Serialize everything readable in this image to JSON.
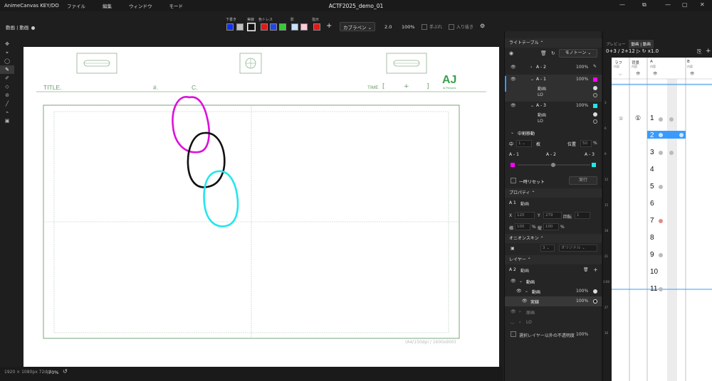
{
  "titlebar": {
    "app_name": "AnimeCanvas KEY/DO",
    "menus": [
      "ファイル",
      "編集",
      "ウィンドウ",
      "モード"
    ],
    "document_title": "ACTF2025_demo_01",
    "window_buttons": [
      "—",
      "⧉",
      "—",
      "▢",
      "✕"
    ]
  },
  "toolbar": {
    "layer_name": "動画 | 動画",
    "swatch_labels": [
      "下書き",
      "実線",
      "色トレス",
      "影",
      "指示"
    ],
    "swatches": [
      "#1133ee",
      "#c0c0c0",
      "#111111",
      "#e01818",
      "#2244ee",
      "#33cc33",
      "#c8e0ff",
      "#ffc8dc",
      "#e01818"
    ],
    "add_label": "+",
    "brush_name": "カブラペン",
    "brush_size": "2.0",
    "opacity": "100%",
    "stabilizer_label": "手ぶれ",
    "pressure_label": "入り抜き",
    "gear": "⚙"
  },
  "tools": [
    "✥",
    "⌖",
    "◯",
    "✎",
    "✐",
    "◇",
    "⊘",
    "╱",
    "⌁",
    "▣"
  ],
  "canvas": {
    "title_label": "TITLE.",
    "number_label": "#.",
    "cut_label": "C.",
    "time_label": "TIME",
    "time_bracket_open": "[",
    "time_plus": "+",
    "time_bracket_close": "]",
    "logo_text": "AJ",
    "logo_sub": "AJ Pictures",
    "format_label": "(A4/150dpi / 1600x900)"
  },
  "bottombar": {
    "info": "1920 × 1080px 72dpi",
    "zoom": "70%",
    "undo_icon": "↺"
  },
  "lighttable": {
    "header": "ライトテーブル",
    "mode": "モノトーン",
    "layers": [
      {
        "name": "A - 2",
        "opacity": "100%",
        "color": ""
      },
      {
        "name": "A - 1",
        "opacity": "100%",
        "color": "#ff00ff",
        "subs": [
          "動画",
          "LO"
        ]
      },
      {
        "name": "A - 3",
        "opacity": "100%",
        "color": "#22e6e6",
        "subs": [
          "動画",
          "LO"
        ]
      }
    ]
  },
  "inbetween": {
    "header": "中割移動",
    "mid_label": "中",
    "count": "1",
    "unit": "枚",
    "pos_label": "位置",
    "pos_value": "50",
    "pos_unit": "%",
    "labels": [
      "A - 1",
      "A - 2",
      "A - 3"
    ],
    "reset_label": "一時リセット",
    "run_label": "実行"
  },
  "properties": {
    "header": "プロパティ",
    "name_prefix": "A 1",
    "name": "動画",
    "x_label": "X",
    "x_value": "120",
    "y_label": "Y",
    "y_value": "279",
    "rot_label": "回転",
    "rot_value": "1",
    "w_label": "横",
    "w_value": "100",
    "h_label": "縦",
    "h_value": "100",
    "pct": "%"
  },
  "onion": {
    "header": "オニオンスキン",
    "count": "3",
    "mode": "オリジナル"
  },
  "layers": {
    "header": "レイヤー",
    "current_prefix": "A 2",
    "current": "動画",
    "tree": [
      {
        "name": "動画",
        "opacity": ""
      },
      {
        "name": "動画",
        "opacity": "100%"
      },
      {
        "name": "実線",
        "opacity": "100%"
      },
      {
        "name": "原画",
        "opacity": ""
      },
      {
        "name": "LO",
        "opacity": ""
      }
    ],
    "lock_label": "選択レイヤー以外の不透明度",
    "lock_value": "100%"
  },
  "timeline": {
    "tabs": [
      "プレビュー",
      "動画 | 動画"
    ],
    "frame_readout": "0+3 / 2+12",
    "speed": "x1.0",
    "columns": [
      "ラフ",
      "背景",
      "A",
      "B"
    ],
    "column_subs": [
      "内容",
      "内容",
      "内容",
      "内容"
    ],
    "frames": [
      "1",
      "2",
      "3",
      "4",
      "5",
      "6",
      "7",
      "8",
      "9",
      "10",
      "11"
    ],
    "row_markers": [
      "3",
      "6",
      "9",
      "12",
      "15",
      "18",
      "21",
      "1:00",
      "27",
      "30"
    ]
  }
}
